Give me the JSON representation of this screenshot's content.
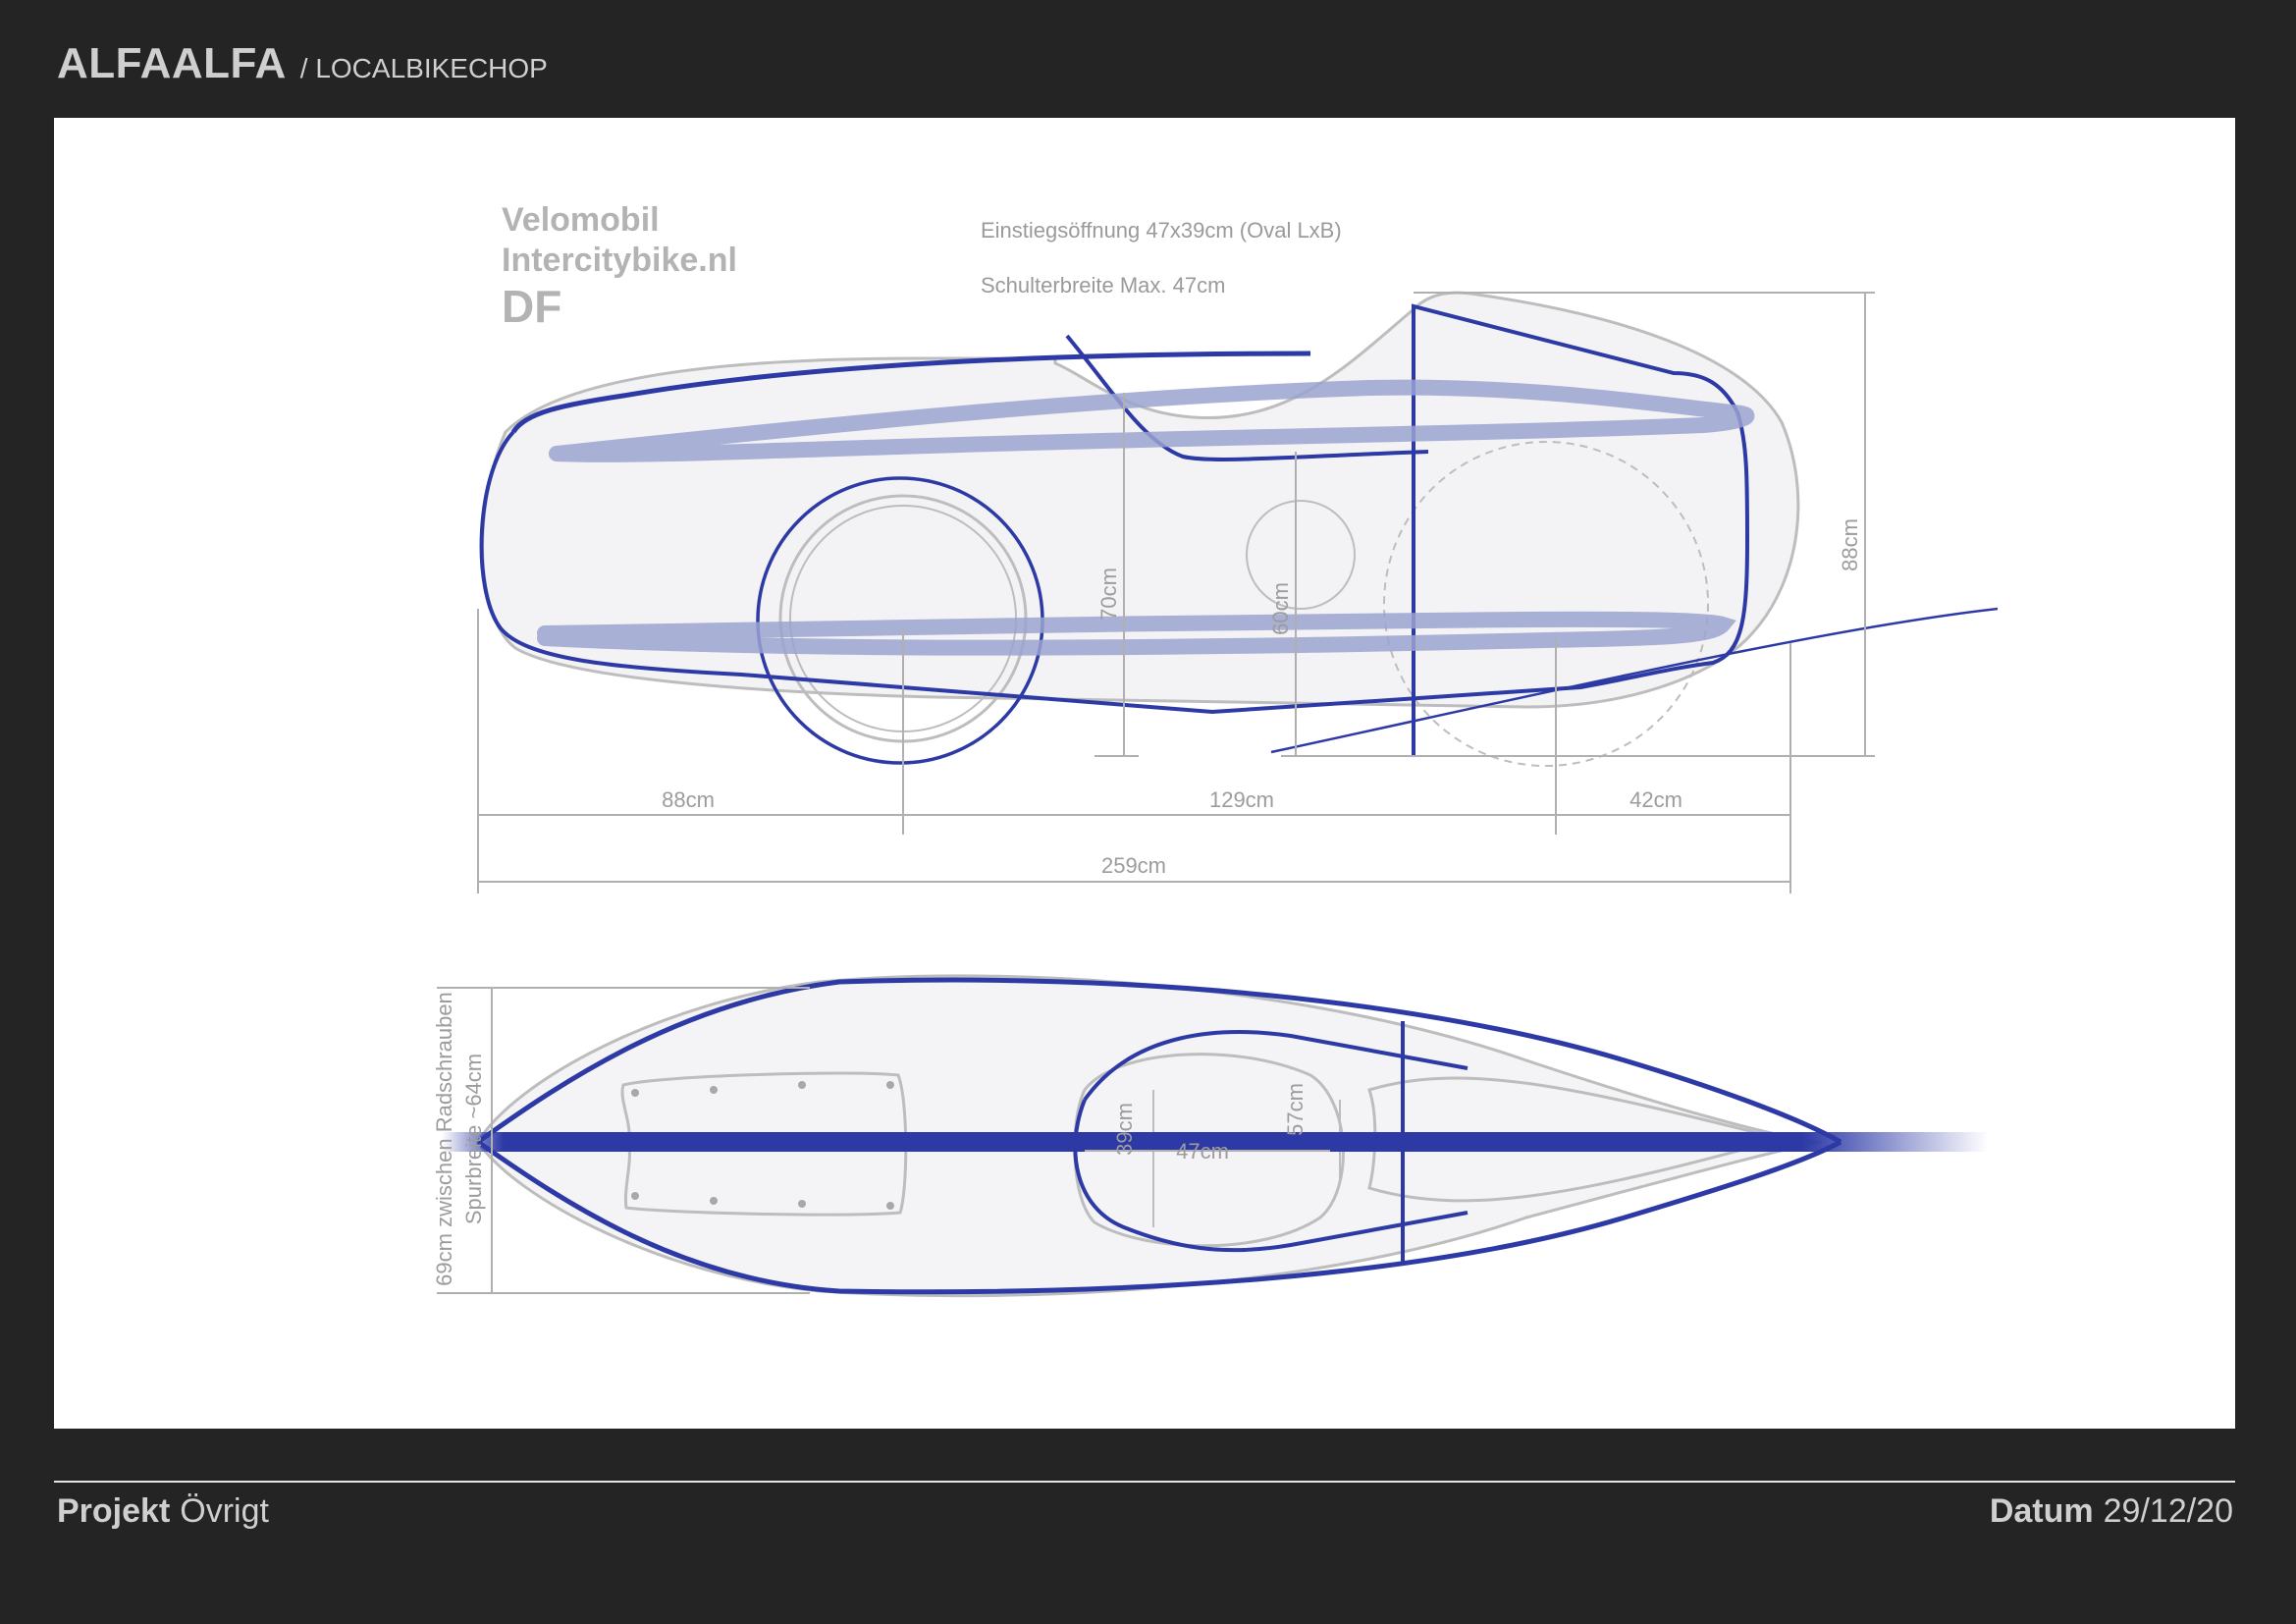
{
  "header": {
    "brand": "ALFAALFA",
    "subbrand": "/ LOCALBIKECHOP"
  },
  "drawing": {
    "maker_line1": "Velomobil",
    "maker_line2": "Intercitybike.nl",
    "maker_line3": "DF",
    "note_entry": "Einstiegsöffnung 47x39cm (Oval LxB)",
    "note_shoulder": "Schulterbreite Max. 47cm",
    "dim_front_length": "88cm",
    "dim_wheelbase": "129cm",
    "dim_rear_length": "42cm",
    "dim_total_length": "259cm",
    "dim_height_70": "70cm",
    "dim_height_60": "60cm",
    "dim_height_88": "88cm",
    "dim_top_width_47": "47cm",
    "dim_top_39": "39cm",
    "dim_top_57": "57cm",
    "dim_track_line1": "69cm zwischen Radschrauben",
    "dim_track_line2": "Spurbreite ~64cm",
    "colors": {
      "sketch_blue": "#2d3aa6",
      "outline_gray": "#bdbdbd"
    }
  },
  "footer": {
    "project_label": "Projekt",
    "project_value": "Övrigt",
    "date_label": "Datum",
    "date_value": "29/12/20"
  }
}
